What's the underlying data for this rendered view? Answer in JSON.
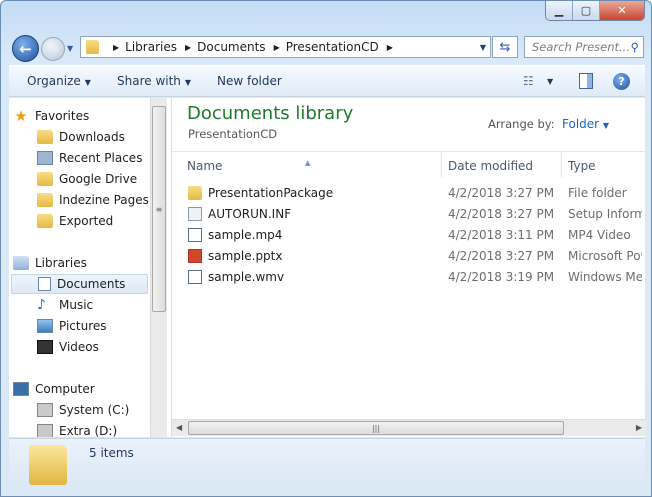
{
  "address": {
    "crumbs": [
      "Libraries",
      "Documents",
      "PresentationCD"
    ]
  },
  "search": {
    "placeholder": "Search Present..."
  },
  "toolbar": {
    "organize": "Organize",
    "share_with": "Share with",
    "new_folder": "New folder"
  },
  "sidebar": {
    "favorites": {
      "label": "Favorites",
      "items": [
        "Downloads",
        "Recent Places",
        "Google Drive",
        "Indezine Pages",
        "Exported"
      ]
    },
    "libraries": {
      "label": "Libraries",
      "items": [
        "Documents",
        "Music",
        "Pictures",
        "Videos"
      ]
    },
    "computer": {
      "label": "Computer",
      "items": [
        "System (C:)",
        "Extra (D:)"
      ]
    }
  },
  "main": {
    "title": "Documents library",
    "subtitle": "PresentationCD",
    "arrange_label": "Arrange by:",
    "arrange_value": "Folder",
    "columns": [
      "Name",
      "Date modified",
      "Type"
    ],
    "files": [
      {
        "name": "PresentationPackage",
        "date": "4/2/2018 3:27 PM",
        "type": "File folder",
        "icon": "folder-icon"
      },
      {
        "name": "AUTORUN.INF",
        "date": "4/2/2018 3:27 PM",
        "type": "Setup Information",
        "icon": "settings-file-icon"
      },
      {
        "name": "sample.mp4",
        "date": "4/2/2018 3:11 PM",
        "type": "MP4 Video",
        "icon": "video-file-icon"
      },
      {
        "name": "sample.pptx",
        "date": "4/2/2018 3:27 PM",
        "type": "Microsoft PowerPoint",
        "icon": "powerpoint-file-icon"
      },
      {
        "name": "sample.wmv",
        "date": "4/2/2018 3:19 PM",
        "type": "Windows Media",
        "icon": "video-file-icon"
      }
    ]
  },
  "status": {
    "count": "5 items"
  }
}
